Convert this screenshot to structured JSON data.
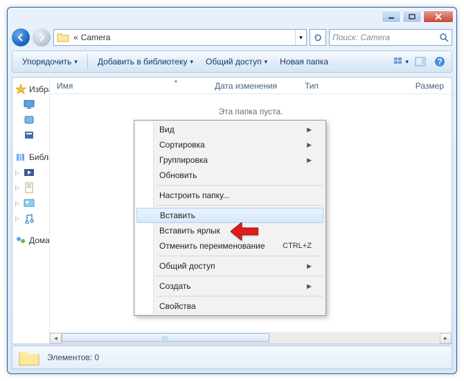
{
  "titlebar": {
    "minimize_title": "Minimize",
    "maximize_title": "Maximize",
    "close_title": "Close"
  },
  "nav": {
    "back_title": "Back",
    "forward_title": "Forward"
  },
  "address": {
    "crumb_sep": "«",
    "folder": "Camera",
    "dropdown_title": "Previous locations",
    "refresh_title": "Refresh"
  },
  "search": {
    "placeholder": "Поиск: Camera"
  },
  "toolbar": {
    "organize": "Упорядочить",
    "add_library": "Добавить в библиотеку",
    "general_access": "Общий доступ",
    "new_folder": "Новая папка",
    "views_title": "Views",
    "preview_title": "Preview pane",
    "help_title": "Help"
  },
  "sidebar": {
    "items": [
      {
        "label": "Избранное",
        "kind": "fav"
      },
      {
        "label": "",
        "kind": "desktop"
      },
      {
        "label": "",
        "kind": "downloads"
      },
      {
        "label": "",
        "kind": "recent"
      },
      {
        "label": "Библиотеки",
        "kind": "lib"
      },
      {
        "label": "",
        "kind": "video"
      },
      {
        "label": "",
        "kind": "docs"
      },
      {
        "label": "",
        "kind": "pics"
      },
      {
        "label": "",
        "kind": "music"
      },
      {
        "label": "Домашняя группа",
        "kind": "homegroup"
      }
    ]
  },
  "columns": {
    "name": "Имя",
    "date": "Дата изменения",
    "type": "Тип",
    "size": "Размер"
  },
  "empty_msg": "Эта папка пуста.",
  "context_menu": {
    "view": "Вид",
    "sort": "Сортировка",
    "group": "Группировка",
    "refresh": "Обновить",
    "customize": "Настроить папку...",
    "paste": "Вставить",
    "paste_shortcut": "Вставить ярлык",
    "undo_rename": "Отменить переименование",
    "undo_shortcut": "CTRL+Z",
    "share": "Общий доступ",
    "new": "Создать",
    "properties": "Свойства"
  },
  "status": {
    "text": "Элементов: 0"
  }
}
